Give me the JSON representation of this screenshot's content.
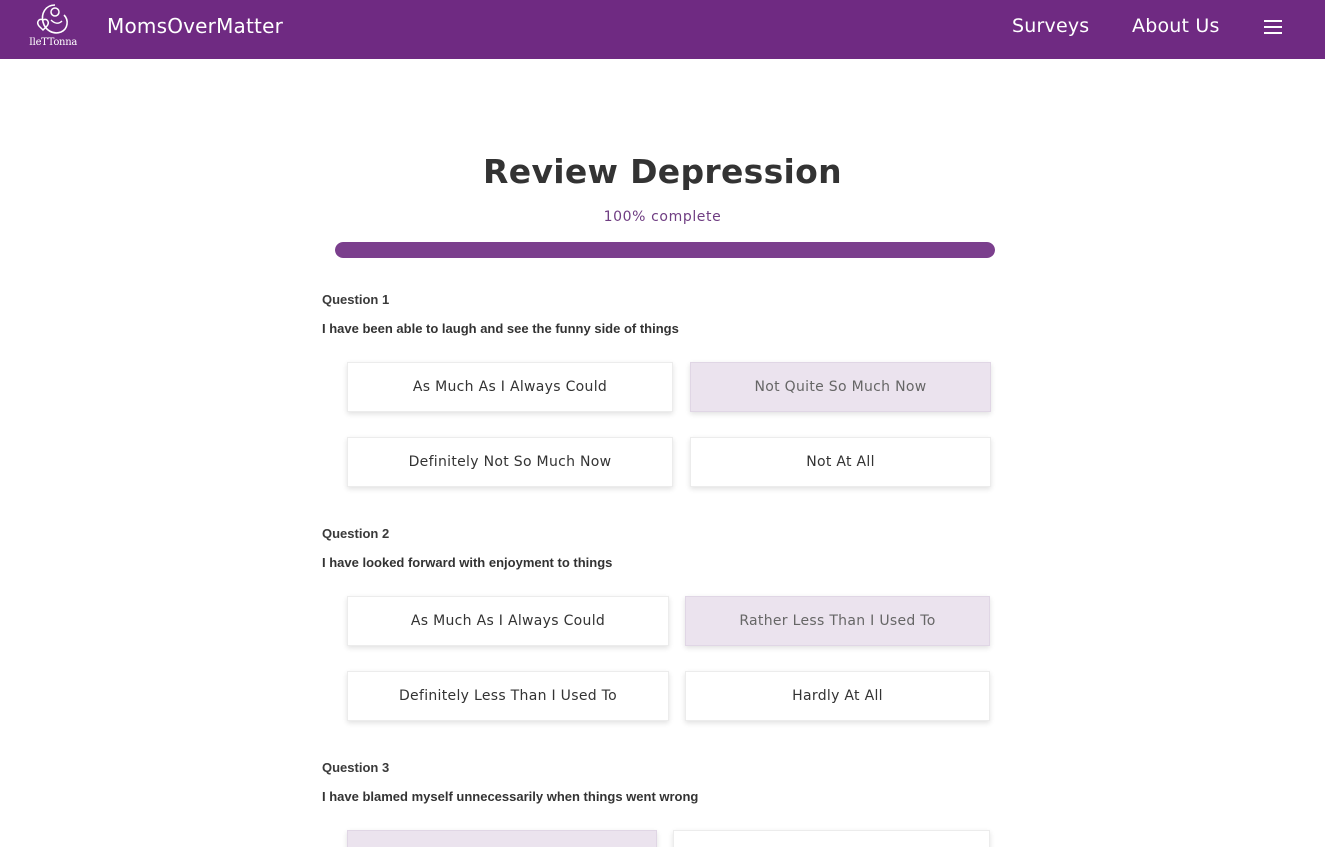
{
  "nav": {
    "logo_text": "IleTTonna",
    "brand": "MomsOverMatter",
    "links": [
      "Surveys",
      "About Us"
    ],
    "menu_icon": "hamburger-menu-icon"
  },
  "page": {
    "title": "Review Depression",
    "progress_label": "100% complete",
    "progress_value": 100
  },
  "questions": [
    {
      "number": "Question 1",
      "text": "I have been able to laugh and see the funny side of things",
      "options": [
        "As Much As I Always Could",
        "Not Quite So Much Now",
        "Definitely Not So Much Now",
        "Not At All"
      ],
      "selected": 1
    },
    {
      "number": "Question 2",
      "text": "I have looked forward with enjoyment to things",
      "options": [
        "As Much As I Always Could",
        "Rather Less Than I Used To",
        "Definitely Less Than I Used To",
        "Hardly At All"
      ],
      "selected": 1
    },
    {
      "number": "Question 3",
      "text": "I have blamed myself unnecessarily when things went wrong",
      "options": [
        "",
        ""
      ],
      "selected": 0
    }
  ],
  "colors": {
    "navbar": "#6f2a82",
    "progress_fill": "#7b3f8d",
    "selected_option": "#ebe3ee"
  }
}
